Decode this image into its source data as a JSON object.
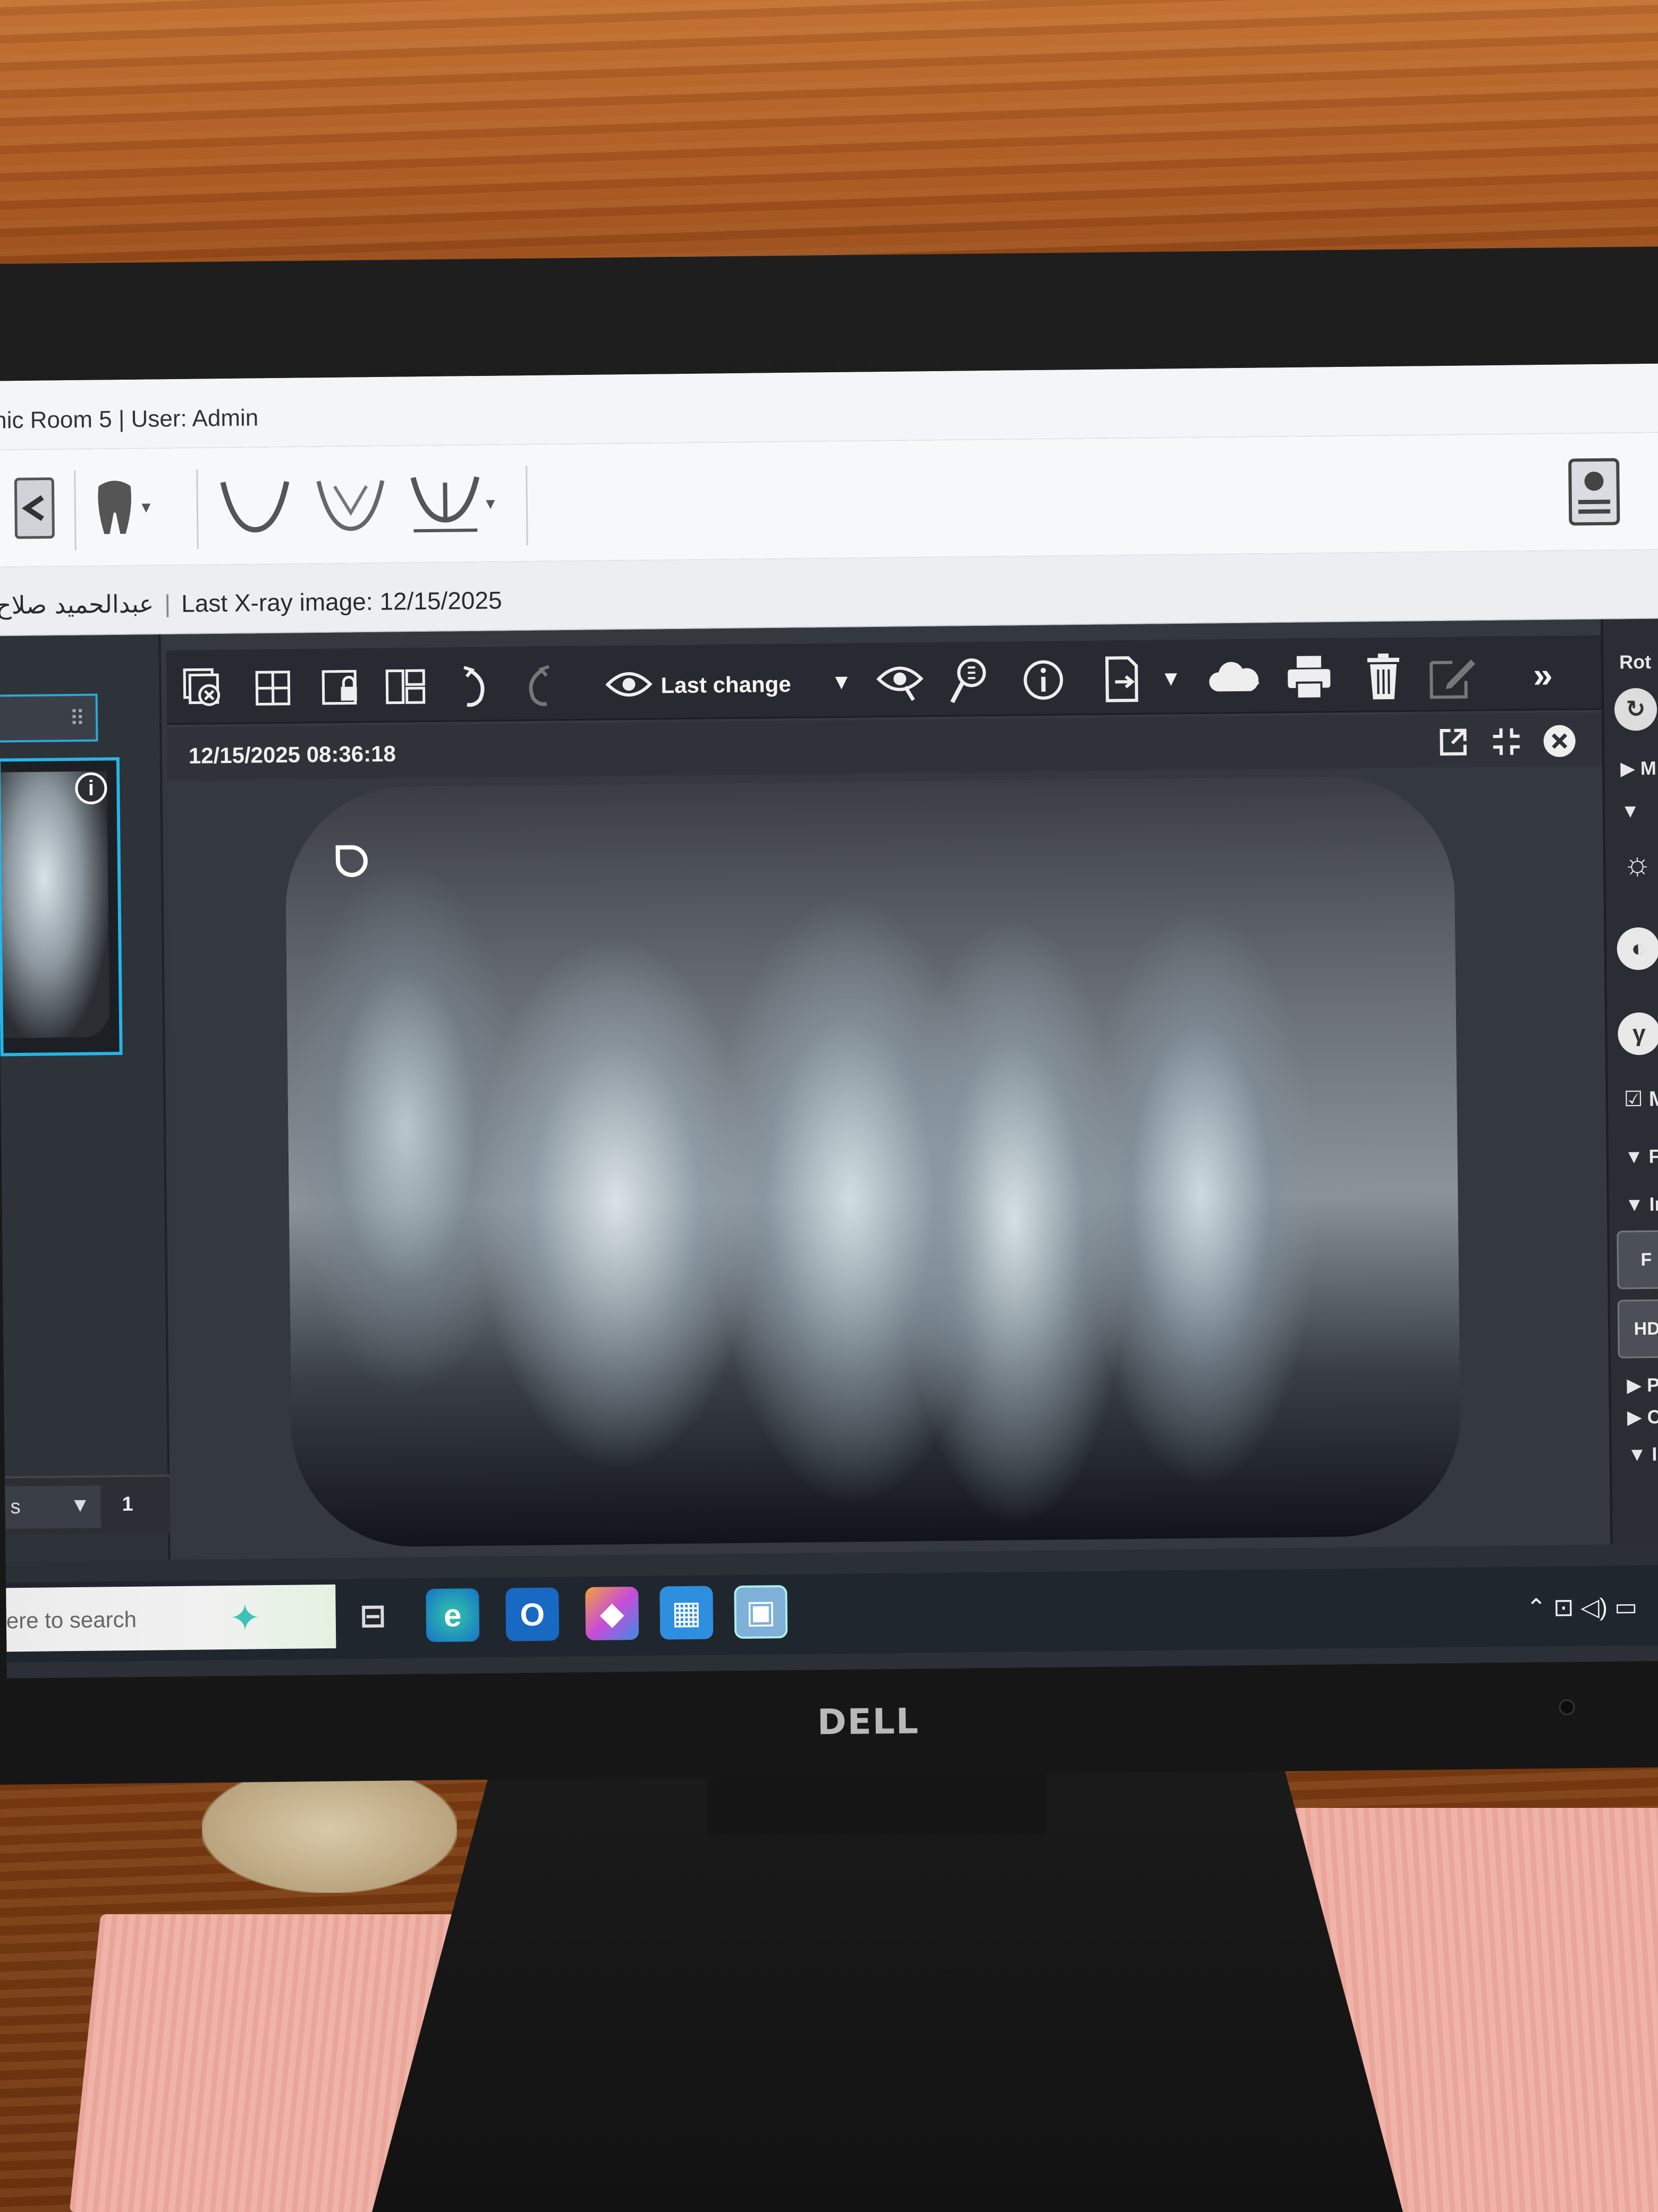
{
  "window": {
    "title": "nic Room 5 | User: Admin"
  },
  "patient_bar": {
    "patient_name": "عبدالحميد صلاح",
    "last_xray_label": "Last X-ray image: 12/15/2025"
  },
  "toolbar": {
    "view_mode_label": "Last change",
    "items": [
      "close-all-icon",
      "grid-icon",
      "lock-layout-icon",
      "layout-icon",
      "undo-icon",
      "redo-icon",
      "eye-icon",
      "eye-search-icon",
      "implant-search-icon",
      "info-icon",
      "export-icon",
      "cloud-upload-icon",
      "print-icon",
      "delete-icon",
      "edit-icon",
      "more-icon"
    ]
  },
  "viewer": {
    "timestamp": "12/15/2025 08:36:18"
  },
  "left_panel": {
    "series_select": "s",
    "count": "1"
  },
  "right_panel": {
    "rotate_label": "Rot",
    "section_m": "M",
    "checkbox_label": "Mo",
    "filter_label": "Filt",
    "intraoral_label": "Intra",
    "tool_f": "F",
    "tool_hd": "HD",
    "panoramic_label": "Panora",
    "cephalo_label": "Cephal",
    "invert_label": "Invert"
  },
  "taskbar": {
    "search_placeholder": "ere to search"
  },
  "monitor": {
    "brand": "DELL"
  },
  "colors": {
    "accent": "#25b5e8",
    "toolbar_bg": "#272a30",
    "viewer_bg": "#34383f"
  }
}
